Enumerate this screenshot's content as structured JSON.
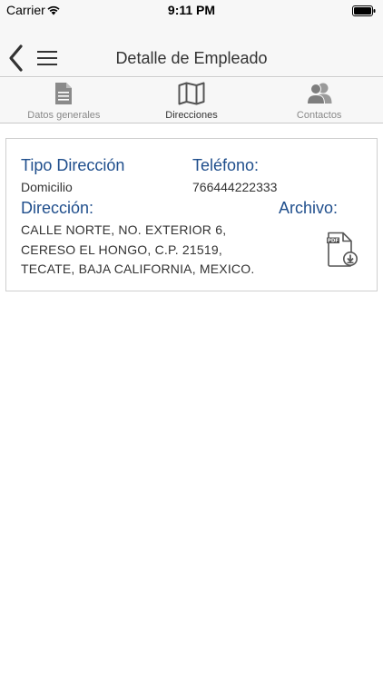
{
  "status_bar": {
    "carrier": "Carrier",
    "time": "9:11 PM"
  },
  "nav": {
    "title": "Detalle de Empleado",
    "back_icon": "chevron-left-icon",
    "menu_icon": "hamburger-menu-icon"
  },
  "tabs": [
    {
      "label": "Datos generales",
      "icon": "document-icon",
      "active": false
    },
    {
      "label": "Direcciones",
      "icon": "map-icon",
      "active": true
    },
    {
      "label": "Contactos",
      "icon": "contacts-icon",
      "active": false
    }
  ],
  "address": {
    "tipo_label": "Tipo Dirección",
    "tipo_value": "Domicilio",
    "telefono_label": "Teléfono:",
    "telefono_value": "766444222333",
    "direccion_label": "Dirección:",
    "direccion_value": "CALLE NORTE, NO. EXTERIOR 6, CERESO EL HONGO, C.P. 21519, TECATE, BAJA CALIFORNIA, MEXICO.",
    "archivo_label": "Archivo:",
    "archivo_icon": "pdf-download-icon",
    "archivo_icon_text": "PDF"
  },
  "colors": {
    "label_blue": "#1f4e8c",
    "bar_background": "#f7f7f7"
  }
}
